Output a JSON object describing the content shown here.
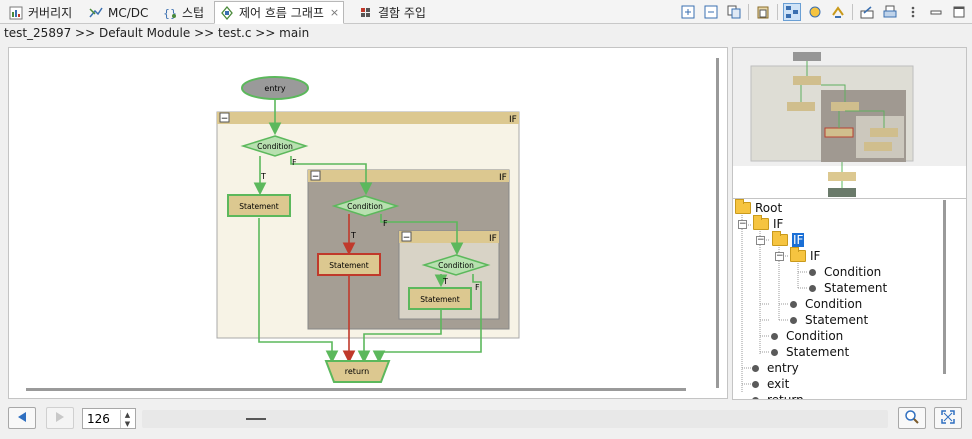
{
  "tabs": [
    {
      "label": "커버리지",
      "icon": "coverage-icon",
      "active": false
    },
    {
      "label": "MC/DC",
      "icon": "mcdc-icon",
      "active": false
    },
    {
      "label": "스텁",
      "icon": "stub-icon",
      "active": false
    },
    {
      "label": "제어 흐름 그래프",
      "icon": "control-flow-graph-icon",
      "active": true,
      "close": "×"
    },
    {
      "label": "결함 주입",
      "icon": "fault-injection-icon",
      "active": false
    }
  ],
  "toolbar": {
    "icons": [
      "expand-all-icon",
      "collapse-all-icon",
      "copy-icon",
      "paste-icon",
      "layout-icon",
      "highlight-icon",
      "link-icon",
      "export-icon",
      "print-icon",
      "more-icon",
      "minimize-icon",
      "maximize-icon"
    ]
  },
  "breadcrumb": "test_25897 >> Default Module >> test.c >> main",
  "graph": {
    "entry": "entry",
    "return": "return",
    "if_label": "IF",
    "collapse": "−",
    "condition": "Condition",
    "statement": "Statement",
    "true_label": "T",
    "false_label": "F"
  },
  "tree": [
    {
      "label": "Root",
      "type": "folder",
      "expander": ""
    },
    {
      "label": "IF",
      "type": "folder",
      "expander": "−"
    },
    {
      "label": "IF",
      "type": "folder",
      "expander": "−",
      "selected": true
    },
    {
      "label": "IF",
      "type": "folder",
      "expander": "−"
    },
    {
      "label": "Condition",
      "type": "leaf"
    },
    {
      "label": "Statement",
      "type": "leaf"
    },
    {
      "label": "Condition",
      "type": "leaf"
    },
    {
      "label": "Statement",
      "type": "leaf"
    },
    {
      "label": "Condition",
      "type": "leaf"
    },
    {
      "label": "Statement",
      "type": "leaf"
    },
    {
      "label": "entry",
      "type": "leaf"
    },
    {
      "label": "exit",
      "type": "leaf"
    },
    {
      "label": "return",
      "type": "leaf"
    }
  ],
  "bottom": {
    "zoom_value": "126",
    "back_icon": "back-arrow-icon",
    "forward_icon": "forward-arrow-icon",
    "zoom_in_icon": "zoom-search-icon",
    "fit_icon": "fit-to-window-icon"
  },
  "colors": {
    "edge_green": "#5cb85c",
    "edge_red": "#c0392b",
    "statement_fill": "#dcc890",
    "condition_fill": "#b8e0b0",
    "if_header": "#dcc890",
    "selection": "#1a6fd6"
  }
}
